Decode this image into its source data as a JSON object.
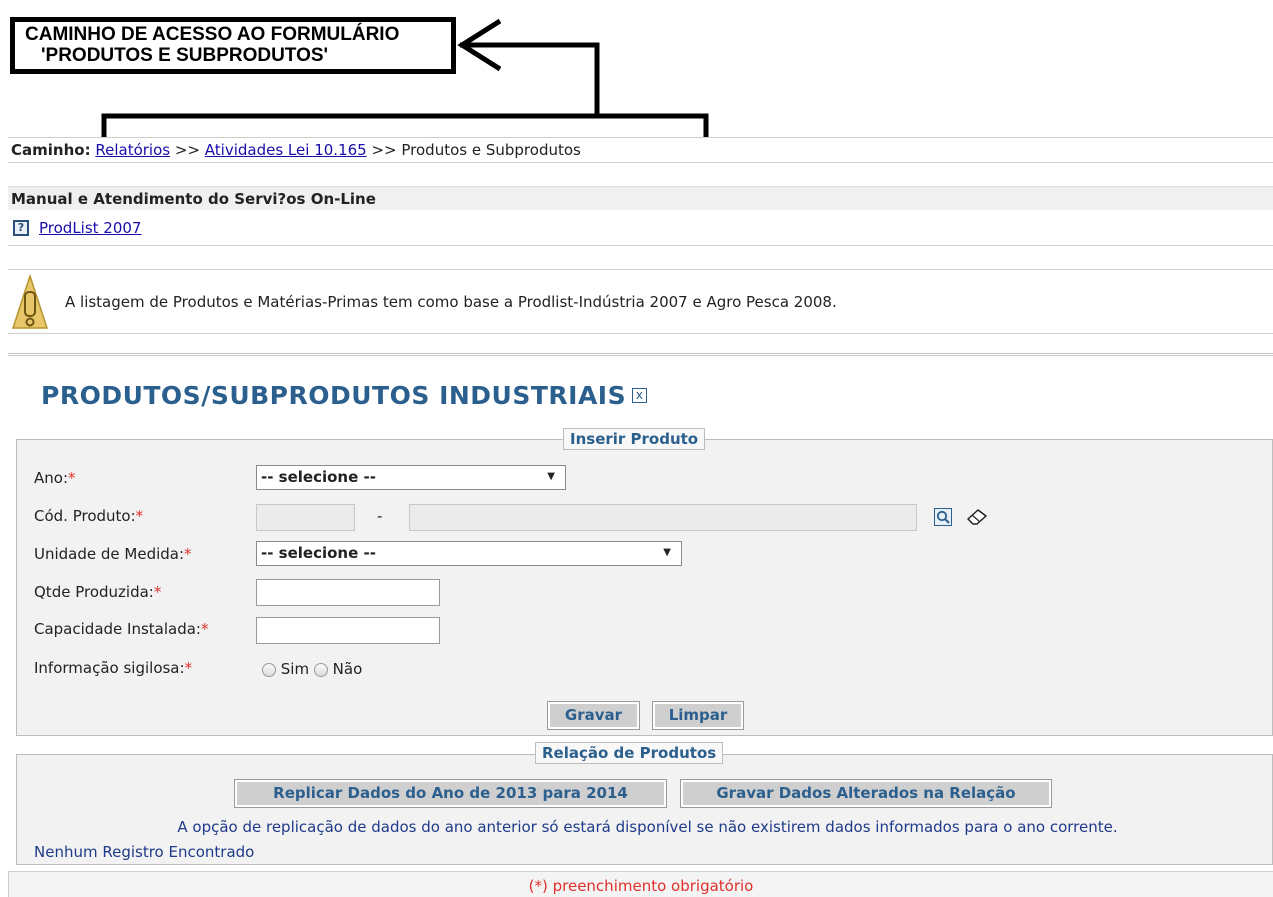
{
  "annotation": {
    "line1": "CAMINHO DE ACESSO AO FORMULÁRIO",
    "line2": "'PRODUTOS E SUBPRODUTOS'"
  },
  "breadcrumb": {
    "label": "Caminho:",
    "link1": "Relatórios",
    "sep": ">>",
    "link2": "Atividades Lei 10.165",
    "current": "Produtos e Subprodutos"
  },
  "manual": {
    "heading": "Manual e Atendimento do Servi?os On-Line",
    "link": "ProdList 2007"
  },
  "warning": {
    "text": "A listagem de Produtos e Matérias-Primas tem como base a Prodlist-Indústria 2007 e Agro Pesca 2008."
  },
  "page": {
    "title": "PRODUTOS/SUBPRODUTOS INDUSTRIAIS",
    "close_glyph": "x"
  },
  "form": {
    "legend": "Inserir Produto",
    "required_mark": "*",
    "ano_label": "Ano:",
    "ano_value": "-- selecione --",
    "cod_label": "Cód. Produto:",
    "cod_separator": "-",
    "unidade_label": "Unidade de Medida:",
    "unidade_value": "-- selecione --",
    "qtde_label": "Qtde Produzida:",
    "capacidade_label": "Capacidade Instalada:",
    "sigilosa_label": "Informação sigilosa:",
    "option_sim": "Sim",
    "option_nao": "Não",
    "save_button": "Gravar",
    "clear_button": "Limpar"
  },
  "relacao": {
    "legend": "Relação de Produtos",
    "replicate_button": "Replicar Dados do Ano de 2013 para 2014",
    "save_changes_button": "Gravar Dados Alterados na Relação",
    "note": "A opção de replicação de dados do ano anterior só estará disponível se não existirem dados informados para o ano corrente.",
    "empty": "Nenhum Registro Encontrado"
  },
  "footer": {
    "text": "(*) preenchimento obrigatório"
  }
}
